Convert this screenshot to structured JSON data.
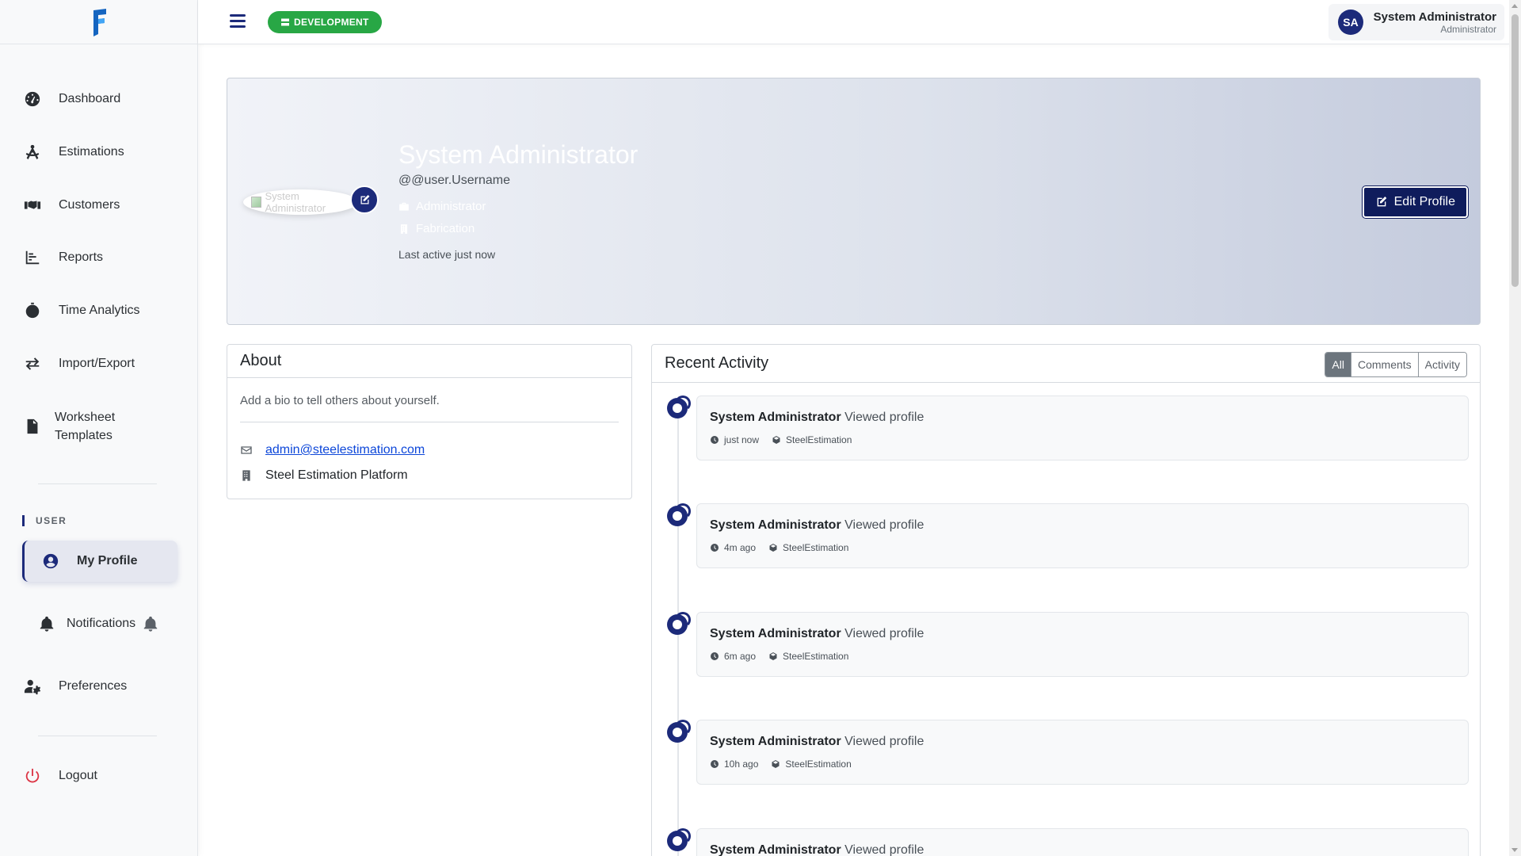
{
  "app": {
    "title": "SteelEstimation",
    "environment": "DEVELOPMENT"
  },
  "sidebar": {
    "items": [
      {
        "label": "Dashboard",
        "icon": "gauge-icon"
      },
      {
        "label": "Estimations",
        "icon": "drafting-compass-icon"
      },
      {
        "label": "Customers",
        "icon": "handshake-icon"
      },
      {
        "label": "Reports",
        "icon": "chart-bar-icon"
      },
      {
        "label": "Time Analytics",
        "icon": "stopwatch-icon"
      },
      {
        "label": "Import/Export",
        "icon": "exchange-icon"
      },
      {
        "label": "Worksheet Templates",
        "label_line1": "Worksheet",
        "label_line2": "Templates",
        "icon": "file-icon"
      }
    ],
    "section_label": "USER",
    "user_items": [
      {
        "label": "My Profile",
        "icon": "user-circle-icon",
        "active": true
      },
      {
        "label": "Notifications",
        "icon": "bell-icon"
      },
      {
        "label": "Preferences",
        "icon": "user-cog-icon"
      }
    ],
    "logout_label": "Logout"
  },
  "header": {
    "user_initials": "SA",
    "user_name": "System Administrator",
    "user_role": "Administrator"
  },
  "profile": {
    "avatar_alt": "System Administrator",
    "name": "System Administrator",
    "username": "@@user.Username",
    "role": "Administrator",
    "department": "Fabrication",
    "last_active": "Last active just now",
    "edit_label": "Edit Profile"
  },
  "about": {
    "title": "About",
    "bio_placeholder": "Add a bio to tell others about yourself.",
    "email": "admin@steelestimation.com",
    "organization": "Steel Estimation Platform"
  },
  "activity": {
    "title": "Recent Activity",
    "filters": [
      "All",
      "Comments",
      "Activity"
    ],
    "active_filter": "All",
    "items": [
      {
        "user": "System Administrator",
        "action": "Viewed profile",
        "time": "just now",
        "source": "SteelEstimation"
      },
      {
        "user": "System Administrator",
        "action": "Viewed profile",
        "time": "4m ago",
        "source": "SteelEstimation"
      },
      {
        "user": "System Administrator",
        "action": "Viewed profile",
        "time": "6m ago",
        "source": "SteelEstimation"
      },
      {
        "user": "System Administrator",
        "action": "Viewed profile",
        "time": "10h ago",
        "source": "SteelEstimation"
      },
      {
        "user": "System Administrator",
        "action": "Viewed profile",
        "time": "",
        "source": ""
      }
    ]
  },
  "colors": {
    "brand": "#1c2a7a",
    "env_badge": "#28a745",
    "logout": "#dc3545",
    "link": "#0d47d9"
  }
}
